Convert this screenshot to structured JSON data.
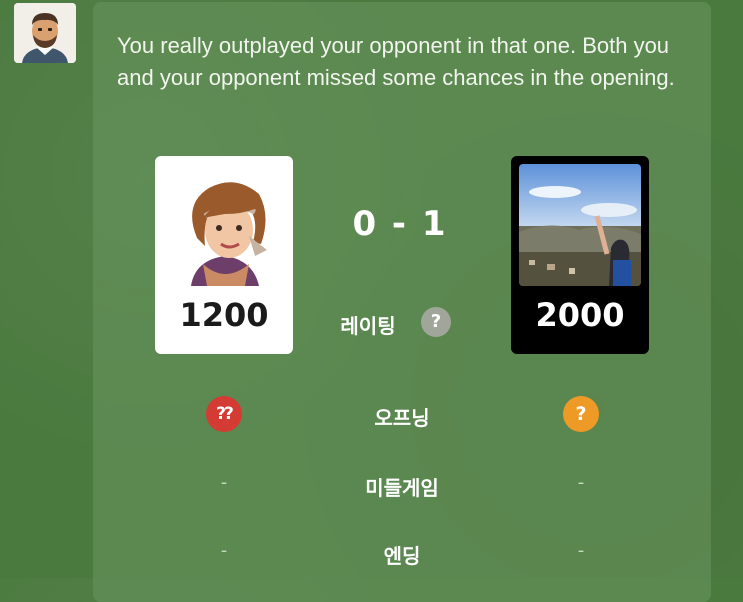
{
  "coach": {
    "message": "You really outplayed your opponent in that one. Both you and your opponent missed some chances in the opening."
  },
  "players": {
    "left": {
      "rating": "1200"
    },
    "right": {
      "rating": "2000"
    }
  },
  "score": "0 - 1",
  "rows": [
    {
      "label": "레이팅",
      "help": "?"
    },
    {
      "label": "오프닝",
      "left": "??",
      "right": "?"
    },
    {
      "label": "미들게임",
      "left": "-",
      "right": "-"
    },
    {
      "label": "엔딩",
      "left": "-",
      "right": "-"
    }
  ],
  "colors": {
    "background": "#4b7a3f",
    "blunder": "#d43b33",
    "mistake": "#ee9a26",
    "help": "#a0a69a"
  },
  "icons": {
    "coach": "coach-avatar-icon",
    "help": "help-icon",
    "blunder": "blunder-icon",
    "mistake": "mistake-icon"
  }
}
